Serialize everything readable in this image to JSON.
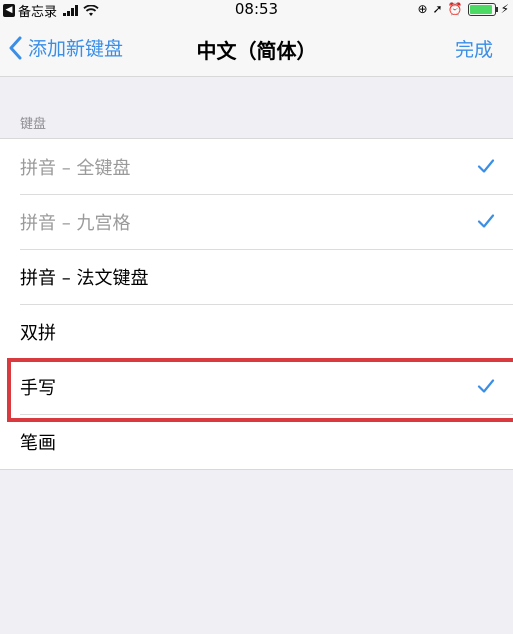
{
  "status_bar": {
    "back_app_label": "备忘录",
    "time": "08:53",
    "icons": [
      "signal-icon",
      "wifi-icon",
      "orientation-lock-icon",
      "location-icon",
      "alarm-icon",
      "battery-icon",
      "charging-icon"
    ],
    "battery_level": 0.85,
    "battery_color": "#4cd964"
  },
  "nav": {
    "back_label": "添加新键盘",
    "title": "中文（简体）",
    "done_label": "完成",
    "accent_color": "#3a8ee6"
  },
  "section": {
    "header": "键盘"
  },
  "keyboards": [
    {
      "label": "拼音 – 全键盘",
      "checked": true,
      "dimmed": true
    },
    {
      "label": "拼音 – 九宫格",
      "checked": true,
      "dimmed": true
    },
    {
      "label": "拼音 – 法文键盘",
      "checked": false,
      "dimmed": false
    },
    {
      "label": "双拼",
      "checked": false,
      "dimmed": false
    },
    {
      "label": "手写",
      "checked": true,
      "dimmed": false,
      "highlighted": true
    },
    {
      "label": "笔画",
      "checked": false,
      "dimmed": false
    }
  ],
  "highlight_color": "#d83a3f"
}
